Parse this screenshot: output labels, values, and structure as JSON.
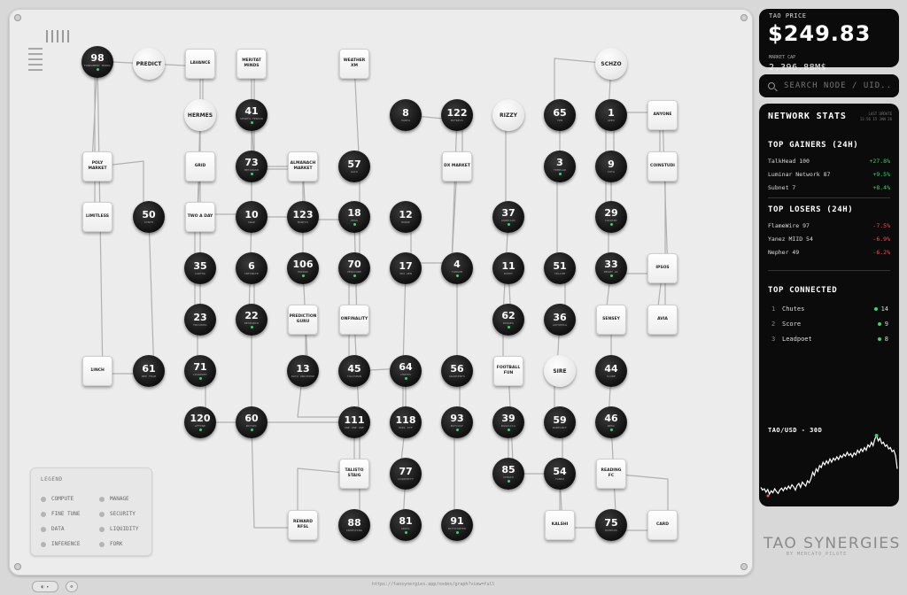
{
  "legend": {
    "title": "LEGEND",
    "items": [
      {
        "label": "COMPUTE"
      },
      {
        "label": "MANAGE"
      },
      {
        "label": "FINE TUNE"
      },
      {
        "label": "SECURITY"
      },
      {
        "label": "DATA"
      },
      {
        "label": "LIQUIDITY"
      },
      {
        "label": "INFERENCE"
      },
      {
        "label": "FORK"
      }
    ]
  },
  "price": {
    "label": "TAO PRICE",
    "value": "$249.83",
    "market_cap_label": "MARKET CAP",
    "market_cap_value": "2,396.88M$"
  },
  "search": {
    "placeholder": "SEARCH NODE / UID..."
  },
  "stats": {
    "title": "NETWORK STATS",
    "gainers_title": "TOP GAINERS (24H)",
    "gainers": [
      {
        "name": "TalkHead 100",
        "change": "+27.8%"
      },
      {
        "name": "Luminar Network 87",
        "change": "+9.5%"
      },
      {
        "name": "Subnet 7",
        "change": "+8.4%"
      }
    ],
    "losers_title": "TOP LOSERS (24H)",
    "losers": [
      {
        "name": "FlameWire 97",
        "change": "-7.5%"
      },
      {
        "name": "Yanez MIID 54",
        "change": "-6.9%"
      },
      {
        "name": "Nepher 49",
        "change": "-6.2%"
      }
    ],
    "connected_title": "TOP CONNECTED",
    "connected": [
      {
        "rank": "1",
        "name": "Chutes",
        "count": "14"
      },
      {
        "rank": "2",
        "name": "Score",
        "count": "9"
      },
      {
        "rank": "3",
        "name": "Leadpoet",
        "count": "8"
      }
    ]
  },
  "chart": {
    "title": "TAO/USD - 30D",
    "accent": "#3ed36a",
    "values": [
      0.22,
      0.18,
      0.2,
      0.15,
      0.19,
      0.12,
      0.17,
      0.14,
      0.2,
      0.16,
      0.13,
      0.18,
      0.21,
      0.17,
      0.22,
      0.19,
      0.24,
      0.2,
      0.26,
      0.23,
      0.18,
      0.25,
      0.28,
      0.22,
      0.3,
      0.27,
      0.24,
      0.32,
      0.29,
      0.35,
      0.45,
      0.4,
      0.5,
      0.46,
      0.55,
      0.52,
      0.6,
      0.56,
      0.62,
      0.58,
      0.65,
      0.6,
      0.66,
      0.63,
      0.68,
      0.64,
      0.7,
      0.67,
      0.72,
      0.69,
      0.75,
      0.7,
      0.73,
      0.68,
      0.74,
      0.71,
      0.78,
      0.74,
      0.8,
      0.76,
      0.82,
      0.78,
      0.86,
      0.83,
      0.9,
      0.85,
      0.95,
      1.0,
      0.92,
      0.96,
      0.88,
      0.9,
      0.84,
      0.86,
      0.8,
      0.82,
      0.76,
      0.78,
      0.7,
      0.5
    ]
  },
  "brand": {
    "name": "TAO SYNERGIES",
    "sub": "BY MERCATO_PILOTE"
  },
  "footer": {
    "url": "https://taosynergies.app/nodes/graph?view=full"
  },
  "nodes": [
    {
      "kind": "dark",
      "num": "98",
      "sub": "FUNDAMENT MODEL"
    },
    {
      "kind": "light",
      "label": "PREDICT"
    },
    {
      "kind": "sq",
      "label": "LAVANCE"
    },
    {
      "kind": "sq",
      "label": "MERITAT MINDS"
    },
    {
      "kind": "sq",
      "label": "WEATHER XM"
    },
    {
      "kind": "light",
      "label": "SCHZO"
    },
    {
      "kind": "light",
      "label": "HERMES"
    },
    {
      "kind": "dark",
      "num": "41",
      "sub": "SPORTS TENSOR"
    },
    {
      "kind": "dark",
      "num": "8",
      "sub": "VANTA"
    },
    {
      "kind": "dark",
      "num": "122",
      "sub": "BITRECS"
    },
    {
      "kind": "light",
      "label": "RIZZY"
    },
    {
      "kind": "dark",
      "num": "65",
      "sub": "TPN"
    },
    {
      "kind": "dark",
      "num": "1",
      "sub": "APEX"
    },
    {
      "kind": "sq",
      "label": "ANYONE"
    },
    {
      "kind": "sq",
      "label": "POLY MARKET"
    },
    {
      "kind": "sq",
      "label": "GRID"
    },
    {
      "kind": "dark",
      "num": "73",
      "sub": "METAHASH"
    },
    {
      "kind": "sq",
      "label": "ALMANACH MARKET"
    },
    {
      "kind": "dark",
      "num": "57",
      "sub": "GAIA"
    },
    {
      "kind": "sq",
      "label": "DX MARKET"
    },
    {
      "kind": "dark",
      "num": "3",
      "sub": "TEMPLAR"
    },
    {
      "kind": "dark",
      "num": "9",
      "sub": "IOTA"
    },
    {
      "kind": "sq",
      "label": "COINSTUDI"
    },
    {
      "kind": "sq",
      "label": "LIMITLESS"
    },
    {
      "kind": "dark",
      "num": "50",
      "sub": "SYNTH"
    },
    {
      "kind": "sq",
      "label": "TWO A DAY"
    },
    {
      "kind": "dark",
      "num": "10",
      "sub": "SWAP"
    },
    {
      "kind": "dark",
      "num": "123",
      "sub": "MANTIS"
    },
    {
      "kind": "dark",
      "num": "18",
      "sub": "ZEUS"
    },
    {
      "kind": "dark",
      "num": "12",
      "sub": "HORDE"
    },
    {
      "kind": "dark",
      "num": "37",
      "sub": "AURELIUS"
    },
    {
      "kind": "dark",
      "num": "29",
      "sub": "COLDINT"
    },
    {
      "kind": "dark",
      "num": "35",
      "sub": "CARTHA"
    },
    {
      "kind": "dark",
      "num": "6",
      "sub": "INFINITE"
    },
    {
      "kind": "dark",
      "num": "106",
      "sub": "VOIDAI"
    },
    {
      "kind": "dark",
      "num": "70",
      "sub": "VERICORE"
    },
    {
      "kind": "dark",
      "num": "17",
      "sub": "404 GEN"
    },
    {
      "kind": "dark",
      "num": "4",
      "sub": "TARGON"
    },
    {
      "kind": "dark",
      "num": "11",
      "sub": "DIPPY"
    },
    {
      "kind": "dark",
      "num": "51",
      "sub": "CELIUM"
    },
    {
      "kind": "dark",
      "num": "33",
      "sub": "READY AI"
    },
    {
      "kind": "sq",
      "label": "IPSOS"
    },
    {
      "kind": "dark",
      "num": "23",
      "sub": "TRISHOOL"
    },
    {
      "kind": "dark",
      "num": "22",
      "sub": "DESEARCH"
    },
    {
      "kind": "sq",
      "label": "PREDICTION GURU"
    },
    {
      "kind": "sq",
      "label": "ONFINALITY"
    },
    {
      "kind": "dark",
      "num": "62",
      "sub": "RIDGES"
    },
    {
      "kind": "dark",
      "num": "36",
      "sub": "AUTOPPIA"
    },
    {
      "kind": "sq",
      "label": "SENSEY"
    },
    {
      "kind": "sq",
      "label": "AVIA"
    },
    {
      "kind": "sq",
      "label": "1INCH"
    },
    {
      "kind": "dark",
      "num": "61",
      "sub": "RED TEAM"
    },
    {
      "kind": "dark",
      "num": "71",
      "sub": "LEADPOET"
    },
    {
      "kind": "dark",
      "num": "13",
      "sub": "DATA UNIVERSE"
    },
    {
      "kind": "dark",
      "num": "45",
      "sub": "TALISMAN"
    },
    {
      "kind": "dark",
      "num": "64",
      "sub": "CHUTES"
    },
    {
      "kind": "dark",
      "num": "56",
      "sub": "GRADIENTS"
    },
    {
      "kind": "sq",
      "label": "FOOTBALL FUN"
    },
    {
      "kind": "light",
      "label": "SIRE"
    },
    {
      "kind": "dark",
      "num": "44",
      "sub": "SCORE"
    },
    {
      "kind": "dark",
      "num": "120",
      "sub": "AFFINE"
    },
    {
      "kind": "dark",
      "num": "60",
      "sub": "BITSEC"
    },
    {
      "kind": "dark",
      "num": "111",
      "sub": "ONE ONE ONE"
    },
    {
      "kind": "dark",
      "num": "118",
      "sub": "HODL ETF"
    },
    {
      "kind": "dark",
      "num": "93",
      "sub": "BITCAST"
    },
    {
      "kind": "dark",
      "num": "39",
      "sub": "BASILICA"
    },
    {
      "kind": "dark",
      "num": "59",
      "sub": "BABELBIT"
    },
    {
      "kind": "dark",
      "num": "46",
      "sub": "RESI"
    },
    {
      "kind": "sq",
      "label": "TALISTO STAIG"
    },
    {
      "kind": "dark",
      "num": "77",
      "sub": "LIQUIDITY"
    },
    {
      "kind": "dark",
      "num": "85",
      "sub": "VIDAIO"
    },
    {
      "kind": "dark",
      "num": "54",
      "sub": "YANEZ"
    },
    {
      "kind": "sq",
      "label": "READING FC"
    },
    {
      "kind": "sq",
      "label": "REWARD RFSL"
    },
    {
      "kind": "dark",
      "num": "88",
      "sub": "INVESTING"
    },
    {
      "kind": "dark",
      "num": "81",
      "sub": "GRAIL"
    },
    {
      "kind": "dark",
      "num": "91",
      "sub": "BITSTARTER"
    },
    {
      "kind": "sq",
      "label": "KALSHI"
    },
    {
      "kind": "dark",
      "num": "75",
      "sub": "HIPPIUS"
    },
    {
      "kind": "sq",
      "label": "CARD"
    }
  ]
}
